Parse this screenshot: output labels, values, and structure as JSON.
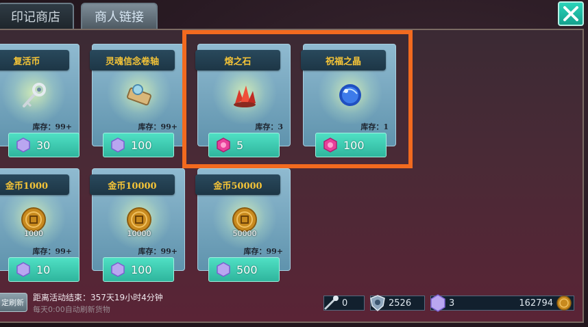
{
  "tabs": [
    {
      "label": "印记商店",
      "active": true
    },
    {
      "label": "商人链接",
      "active": false
    }
  ],
  "items": [
    {
      "name": "复活币",
      "stock": "库存：99+",
      "price": "30",
      "currency": "purple-gem",
      "icon": "key-icon"
    },
    {
      "name": "灵魂信念卷轴",
      "stock": "库存：99+",
      "price": "100",
      "currency": "purple-gem",
      "icon": "scroll-icon"
    },
    {
      "name": "熔之石",
      "stock": "库存：3",
      "price": "5",
      "currency": "pink-gem",
      "icon": "red-crystal-icon"
    },
    {
      "name": "祝福之晶",
      "stock": "库存：1",
      "price": "100",
      "currency": "pink-gem",
      "icon": "blue-orb-icon"
    },
    {
      "name": "金币1000",
      "stock": "库存：99+",
      "price": "10",
      "currency": "purple-gem",
      "icon": "gold-coin-icon",
      "amount": "1000"
    },
    {
      "name": "金币10000",
      "stock": "库存：99+",
      "price": "100",
      "currency": "purple-gem",
      "icon": "gold-coin-icon",
      "amount": "10000"
    },
    {
      "name": "金币50000",
      "stock": "库存：99+",
      "price": "500",
      "currency": "purple-gem",
      "icon": "gold-coin-icon",
      "amount": "50000"
    }
  ],
  "footer": {
    "refresh_button": "定刷新",
    "countdown": "距离活动结束：357天19小时4分钟",
    "refresh_note": "每天0:00自动刷新货物"
  },
  "resources": [
    {
      "name": "wand",
      "value": "0",
      "icon": "wand-icon"
    },
    {
      "name": "shield",
      "value": "2526",
      "icon": "shield-icon"
    },
    {
      "name": "purple-gem",
      "value": "3",
      "icon": "purple-gem-icon"
    },
    {
      "name": "gold",
      "value": "162794",
      "icon": "gold-coin-icon"
    }
  ],
  "colors": {
    "highlight": "#f26a1f",
    "accent": "#2fb59d",
    "title_gold": "#f5c437"
  }
}
